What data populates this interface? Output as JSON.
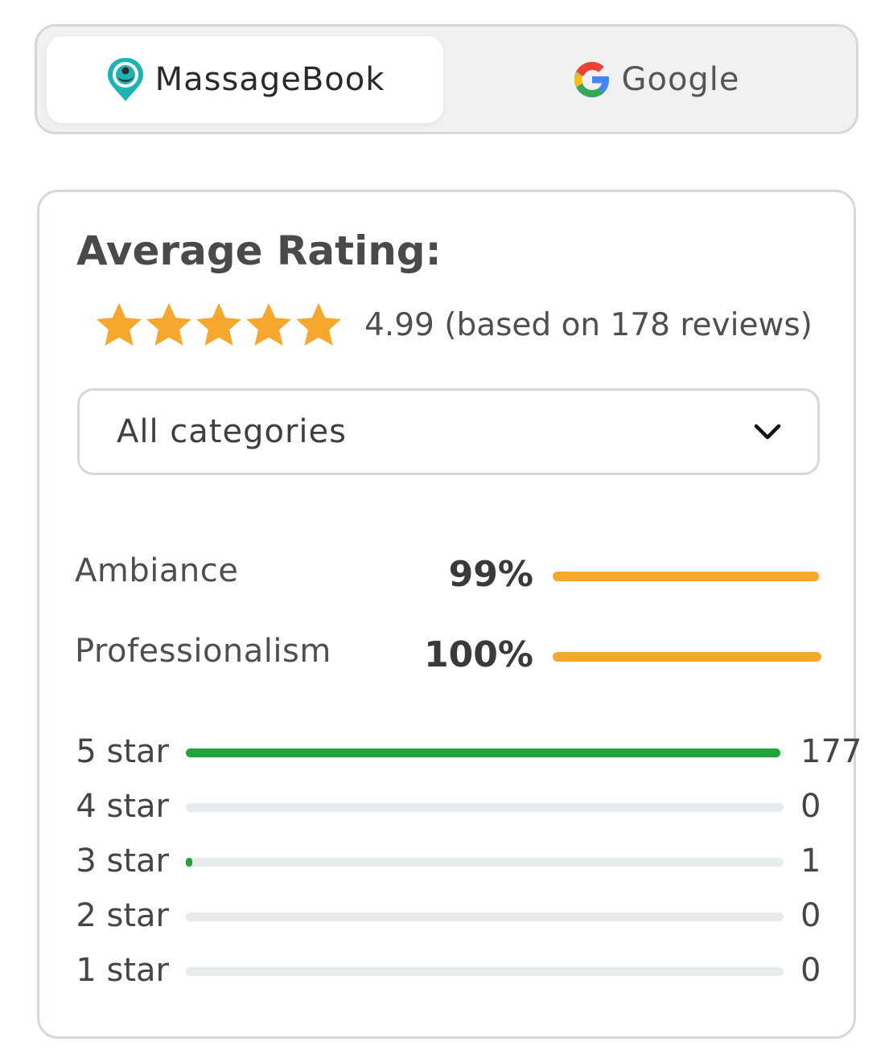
{
  "tabs": [
    {
      "label": "MassageBook",
      "icon": "massagebook-logo-icon",
      "active": true
    },
    {
      "label": "Google",
      "icon": "google-g-icon",
      "active": false
    }
  ],
  "card": {
    "title": "Average Rating:",
    "stars": 5,
    "rating_text": "4.99 (based on 178 reviews)",
    "category_select": {
      "value": "All categories",
      "icon": "chevron-down-icon"
    },
    "categories": [
      {
        "label": "Ambiance",
        "percent": "99%",
        "fill": 0.99
      },
      {
        "label": "Professionalism",
        "percent": "100%",
        "fill": 1.0
      }
    ],
    "distribution": [
      {
        "label": "5 star",
        "count": "177",
        "fill": 0.994
      },
      {
        "label": "4 star",
        "count": "0",
        "fill": 0
      },
      {
        "label": "3 star",
        "count": "1",
        "fill": 0.006
      },
      {
        "label": "2 star",
        "count": "0",
        "fill": 0
      },
      {
        "label": "1 star",
        "count": "0",
        "fill": 0
      }
    ]
  },
  "colors": {
    "star": "#f6a72d",
    "category_bar": "#f6a72d",
    "distribution_bar": "#22a33b",
    "track": "#e7ebee",
    "border": "#d4d8dd",
    "logo_teal": "#1db3b3"
  }
}
